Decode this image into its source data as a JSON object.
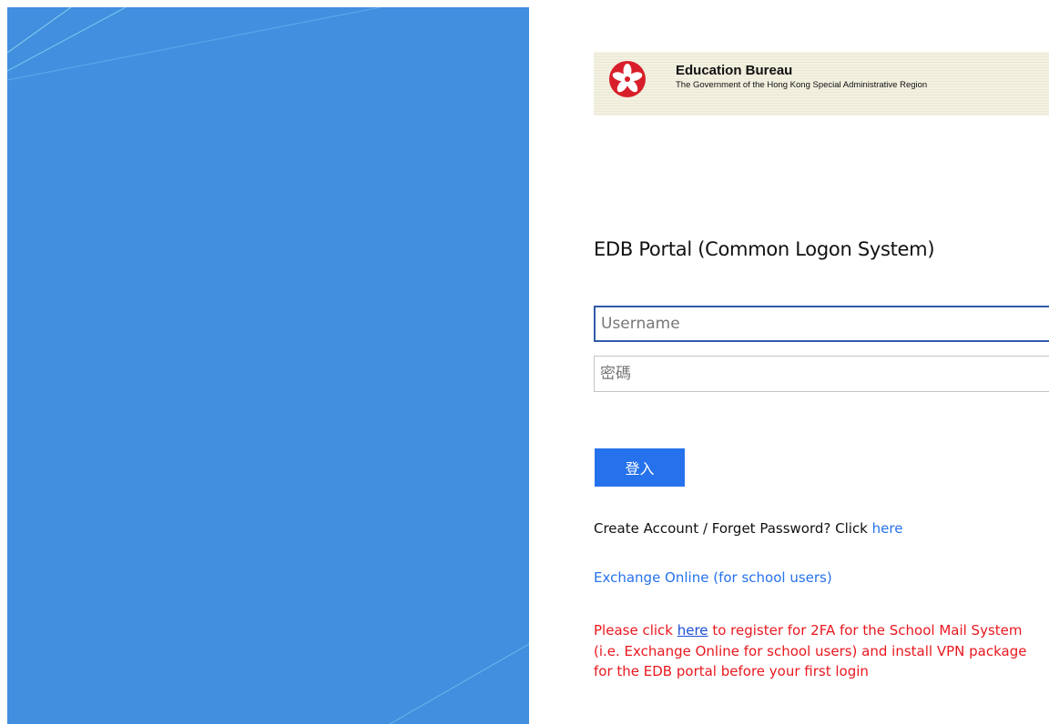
{
  "header": {
    "bureau_name": "Education Bureau",
    "government_name": "The Government of the Hong Kong Special Administrative Region"
  },
  "portal_title": "EDB Portal (Common Logon System)",
  "form": {
    "username": {
      "value": "",
      "placeholder": "Username"
    },
    "password": {
      "value": "",
      "placeholder": "密碼"
    },
    "login_label": "登入"
  },
  "links": {
    "create_account_prefix": "Create Account / Forget Password? Click ",
    "create_account_link": "here",
    "exchange_online": "Exchange Online (for school users)"
  },
  "notice": {
    "prefix": "Please click ",
    "link": "here",
    "suffix": " to register for 2FA for the School Mail System (i.e. Exchange Online for school users) and install VPN package for the EDB portal before your first login"
  },
  "colors": {
    "hero_background": "#418fde",
    "accent": "#2672ec",
    "notice": "#e8181f",
    "focus_border": "#2f5aa8"
  },
  "icons": {
    "emblem": "hk-bauhinia-emblem-icon"
  }
}
